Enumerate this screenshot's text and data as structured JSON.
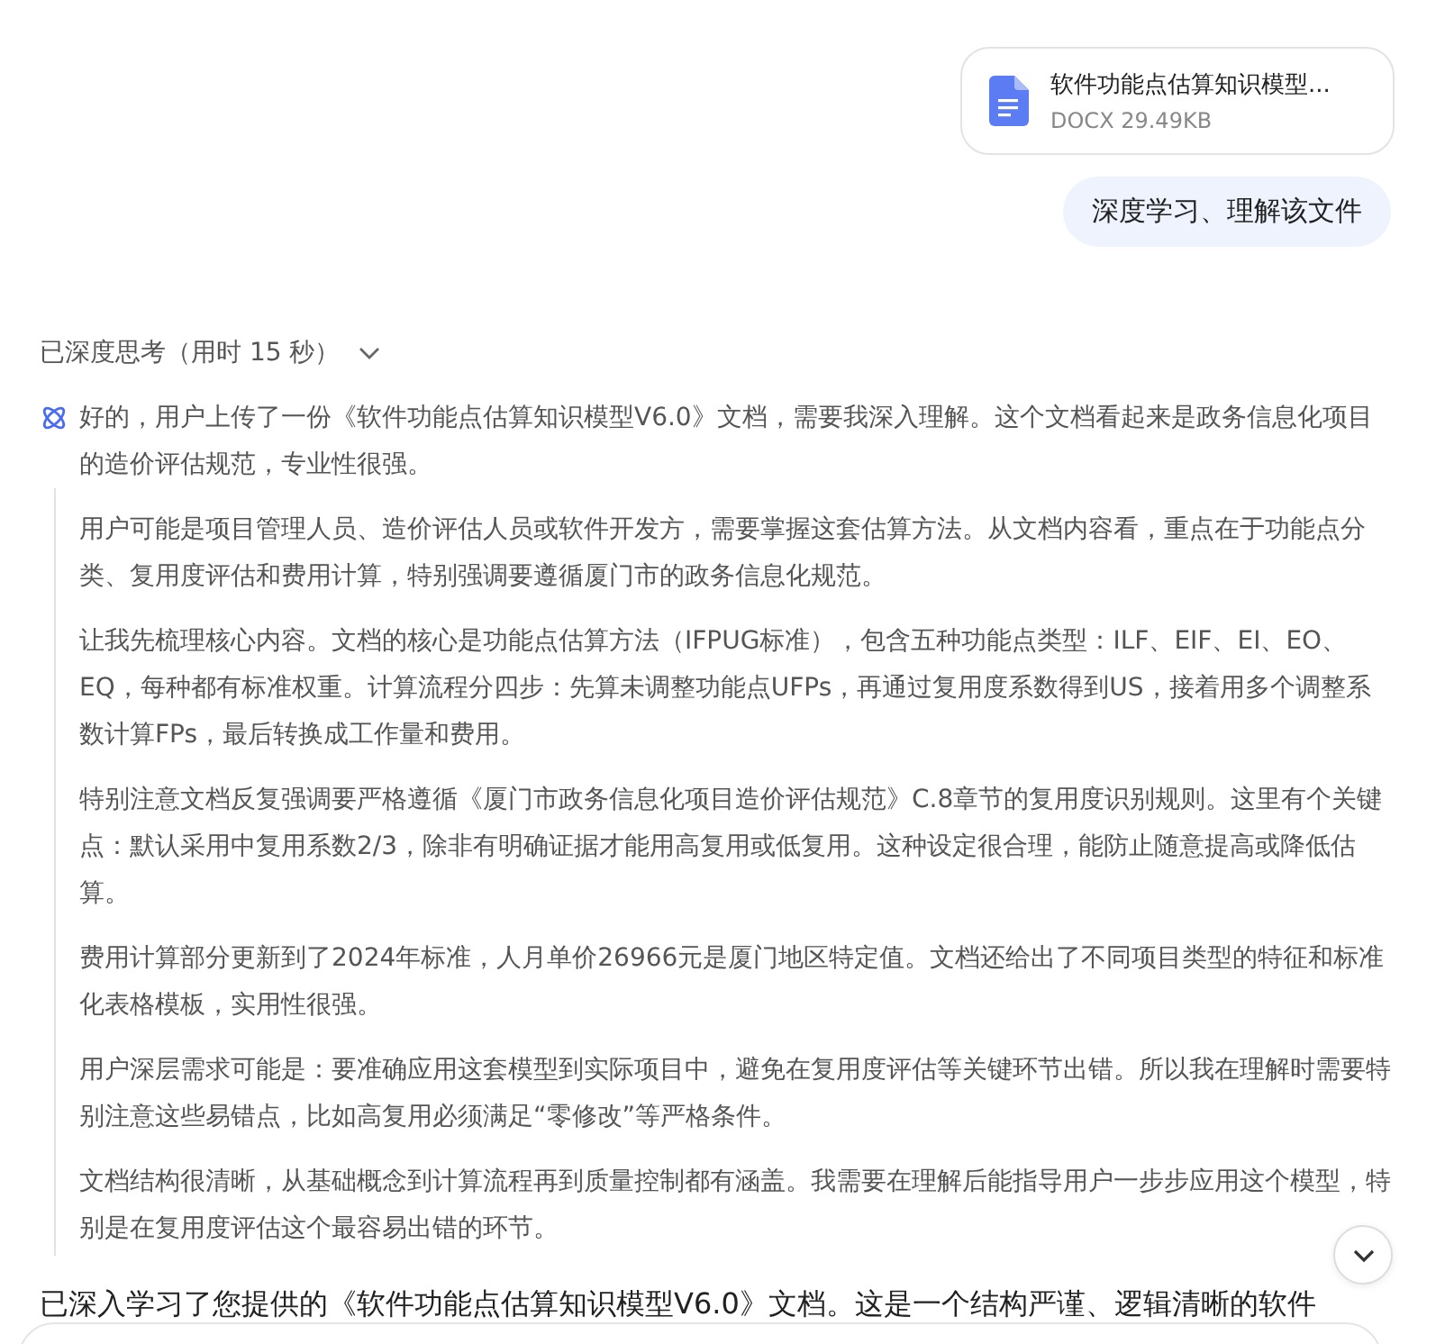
{
  "attachment": {
    "name": "软件功能点估算知识模型...",
    "meta": "DOCX 29.49KB"
  },
  "user_message": "深度学习、理解该文件",
  "thinking": {
    "header": "已深度思考（用时 15 秒）",
    "expanded": true,
    "paragraphs": [
      "好的，用户上传了一份《软件功能点估算知识模型V6.0》文档，需要我深入理解。这个文档看起来是政务信息化项目的造价评估规范，专业性很强。",
      "用户可能是项目管理人员、造价评估人员或软件开发方，需要掌握这套估算方法。从文档内容看，重点在于功能点分类、复用度评估和费用计算，特别强调要遵循厦门市的政务信息化规范。",
      "让我先梳理核心内容。文档的核心是功能点估算方法（IFPUG标准），包含五种功能点类型：ILF、EIF、EI、EO、EQ，每种都有标准权重。计算流程分四步：先算未调整功能点UFPs，再通过复用度系数得到US，接着用多个调整系数计算FPs，最后转换成工作量和费用。",
      "特别注意文档反复强调要严格遵循《厦门市政务信息化项目造价评估规范》C.8章节的复用度识别规则。这里有个关键点：默认采用中复用系数2/3，除非有明确证据才能用高复用或低复用。这种设定很合理，能防止随意提高或降低估算。",
      "费用计算部分更新到了2024年标准，人月单价26966元是厦门地区特定值。文档还给出了不同项目类型的特征和标准化表格模板，实用性很强。",
      "用户深层需求可能是：要准确应用这套模型到实际项目中，避免在复用度评估等关键环节出错。所以我在理解时需要特别注意这些易错点，比如高复用必须满足“零修改”等严格条件。",
      "文档结构很清晰，从基础概念到计算流程再到质量控制都有涵盖。我需要在理解后能指导用户一步步应用这个模型，特别是在复用度评估这个最容易出错的环节。"
    ]
  },
  "answer_lines": [
    "已深入学习了您提供的《软件功能点估算知识模型V6.0》文档。这是一个结构严谨、逻辑清晰的软件"
  ]
}
